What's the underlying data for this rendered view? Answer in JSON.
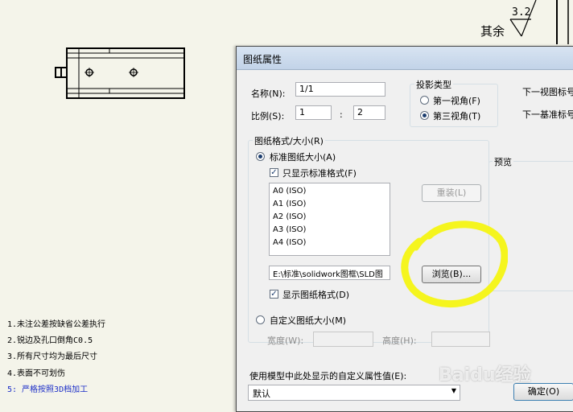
{
  "drawing": {
    "roughness_value": "3.2",
    "roughness_prefix": "其余",
    "notes": [
      "1.未注公差按缺省公差执行",
      "2.锐边及孔口倒角C0.5",
      "3.所有尺寸均为最后尺寸",
      "4.表面不可划伤",
      "5: 严格按照3D档加工"
    ],
    "highlight_color": "#f5f51e"
  },
  "dialog": {
    "title": "图纸属性",
    "name_label": "名称(N):",
    "name_value": "1/1",
    "scale_label": "比例(S):",
    "scale_a": "1",
    "scale_sep": ":",
    "scale_b": "2",
    "projection_label": "投影类型",
    "first_angle": "第一视角(F)",
    "third_angle": "第三视角(T)",
    "next_view_label": "下一视图标号",
    "next_datum_label": "下一基准标号",
    "format_group_label": "图纸格式/大小(R)",
    "standard_size": "标准图纸大小(A)",
    "only_standard": "只显示标准格式(F)",
    "sizes": [
      "A0 (ISO)",
      "A1 (ISO)",
      "A2 (ISO)",
      "A3 (ISO)",
      "A4 (ISO)"
    ],
    "reload_button": "重装(L)",
    "path_value": "E:\\标准\\solidwork图框\\SLD图",
    "browse_button": "浏览(B)...",
    "show_format": "显示图纸格式(D)",
    "custom_size": "自定义图纸大小(M)",
    "width_label": "宽度(W):",
    "height_label": "高度(H):",
    "preview_label": "预览",
    "custom_prop_label": "使用模型中此处显示的自定义属性值(E):",
    "custom_prop_value": "默认",
    "ok_button": "确定(O)"
  },
  "watermark": "Baidu经验"
}
